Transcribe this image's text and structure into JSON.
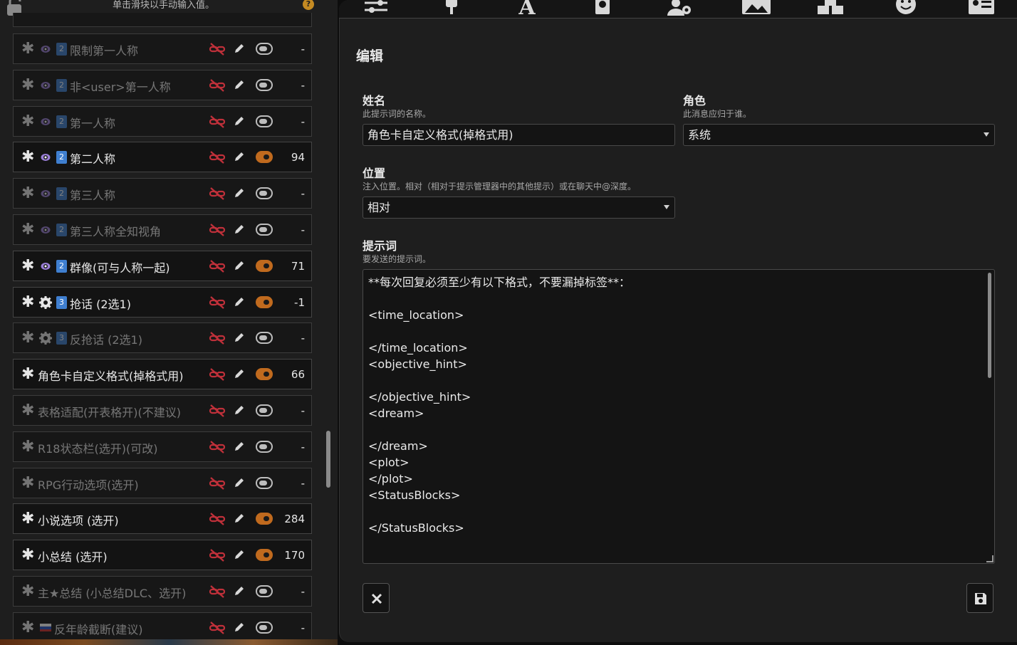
{
  "left": {
    "hint": "单击滑块以手动输入值。",
    "help": "?"
  },
  "prompts": [
    {
      "name": "限制第一人称",
      "icon": "eye",
      "badge": "2",
      "enabled": false,
      "tokens": "-"
    },
    {
      "name": "非<user>第一人称",
      "icon": "eye",
      "badge": "2",
      "enabled": false,
      "tokens": "-"
    },
    {
      "name": "第一人称",
      "icon": "eye",
      "badge": "2",
      "enabled": false,
      "tokens": "-"
    },
    {
      "name": "第二人称",
      "icon": "eye",
      "badge": "2",
      "enabled": true,
      "tokens": "94"
    },
    {
      "name": "第三人称",
      "icon": "eye",
      "badge": "2",
      "enabled": false,
      "tokens": "-"
    },
    {
      "name": "第三人称全知视角",
      "icon": "eye",
      "badge": "2",
      "enabled": false,
      "tokens": "-"
    },
    {
      "name": "群像(可与人称一起)",
      "icon": "eye",
      "badge": "2",
      "enabled": true,
      "tokens": "71"
    },
    {
      "name": "抢话 (2选1)",
      "icon": "gear",
      "badge": "3",
      "enabled": true,
      "tokens": "-1"
    },
    {
      "name": "反抢话 (2选1)",
      "icon": "gear",
      "badge": "3",
      "enabled": false,
      "tokens": "-"
    },
    {
      "name": "角色卡自定义格式(掉格式用)",
      "icon": "",
      "badge": "",
      "enabled": true,
      "tokens": "66"
    },
    {
      "name": "表格适配(开表格开)(不建议)",
      "icon": "",
      "badge": "",
      "enabled": false,
      "tokens": "-"
    },
    {
      "name": "R18状态栏(选开)(可改)",
      "icon": "",
      "badge": "",
      "enabled": false,
      "tokens": "-"
    },
    {
      "name": "RPG行动选项(选开)",
      "icon": "",
      "badge": "",
      "enabled": false,
      "tokens": "-"
    },
    {
      "name": "小说选项 (选开)",
      "icon": "",
      "badge": "",
      "enabled": true,
      "tokens": "284"
    },
    {
      "name": "小总结 (选开)",
      "icon": "",
      "badge": "",
      "enabled": true,
      "tokens": "170"
    },
    {
      "name": "主★总结 (小总结DLC、选开)",
      "icon": "",
      "badge": "",
      "enabled": false,
      "tokens": "-"
    },
    {
      "name": "反年龄截断(建议)",
      "icon": "flag",
      "badge": "",
      "enabled": false,
      "tokens": "-"
    }
  ],
  "editor": {
    "title": "编辑",
    "name_label": "姓名",
    "name_desc": "此提示词的名称。",
    "name_value": "角色卡自定义格式(掉格式用)",
    "role_label": "角色",
    "role_desc": "此消息应归于谁。",
    "role_value": "系统",
    "position_label": "位置",
    "position_desc": "注入位置。相对（相对于提示管理器中的其他提示）或在聊天中@深度。",
    "position_value": "相对",
    "prompt_label": "提示词",
    "prompt_desc": "要发送的提示词。",
    "prompt_text": "**每次回复必须至少有以下格式，不要漏掉标签**：\n\n<time_location>\n\n</time_location>\n<objective_hint>\n\n</objective_hint>\n<dream>\n\n</dream>\n<plot>\n</plot>\n<StatusBlocks>\n\n</StatusBlocks>"
  },
  "colors": {
    "accent": "#c06a1e",
    "badge": "#3f7fd0",
    "unlink": "#c0303a"
  }
}
